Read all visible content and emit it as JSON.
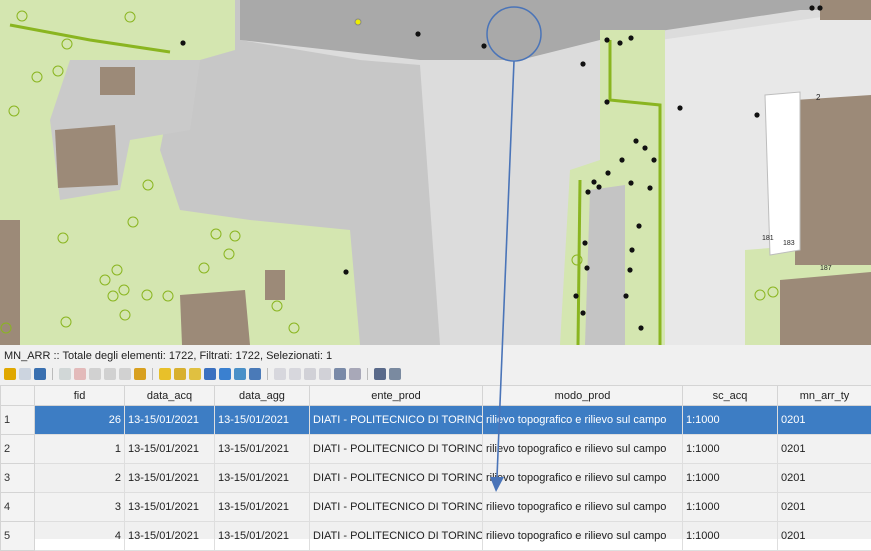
{
  "attribute_table": {
    "status": "MN_ARR :: Totale degli elementi: 1722, Filtrati: 1722, Selezionati: 1",
    "columns": [
      "fid",
      "data_acq",
      "data_agg",
      "ente_prod",
      "modo_prod",
      "sc_acq",
      "mn_arr_ty"
    ],
    "rows": [
      {
        "row": "1",
        "fid": "26",
        "data_acq": "13-15/01/2021",
        "data_agg": "13-15/01/2021",
        "ente_prod": "DIATI - POLITECNICO DI TORINO",
        "modo_prod": "rilievo topografico e rilievo sul campo",
        "sc_acq": "1:1000",
        "mn_arr_ty": "0201",
        "selected": true
      },
      {
        "row": "2",
        "fid": "1",
        "data_acq": "13-15/01/2021",
        "data_agg": "13-15/01/2021",
        "ente_prod": "DIATI - POLITECNICO DI TORINO",
        "modo_prod": "rilievo topografico e rilievo sul campo",
        "sc_acq": "1:1000",
        "mn_arr_ty": "0201",
        "selected": false
      },
      {
        "row": "3",
        "fid": "2",
        "data_acq": "13-15/01/2021",
        "data_agg": "13-15/01/2021",
        "ente_prod": "DIATI - POLITECNICO DI TORINO",
        "modo_prod": "rilievo topografico e rilievo sul campo",
        "sc_acq": "1:1000",
        "mn_arr_ty": "0201",
        "selected": false
      },
      {
        "row": "4",
        "fid": "3",
        "data_acq": "13-15/01/2021",
        "data_agg": "13-15/01/2021",
        "ente_prod": "DIATI - POLITECNICO DI TORINO",
        "modo_prod": "rilievo topografico e rilievo sul campo",
        "sc_acq": "1:1000",
        "mn_arr_ty": "0201",
        "selected": false
      },
      {
        "row": "5",
        "fid": "4",
        "data_acq": "13-15/01/2021",
        "data_agg": "13-15/01/2021",
        "ente_prod": "DIATI - POLITECNICO DI TORINO",
        "modo_prod": "rilievo topografico e rilievo sul campo",
        "sc_acq": "1:1000",
        "mn_arr_ty": "0201",
        "selected": false
      }
    ]
  },
  "toolbar_icons": [
    "pencil-icon",
    "save-icon",
    "reload-icon",
    "add-feature-icon",
    "delete-icon",
    "cut-icon",
    "copy-icon",
    "paste-icon",
    "expression-icon",
    "select-all-icon",
    "invert-selection-icon",
    "deselect-icon",
    "filter-icon",
    "move-selection-top-icon",
    "pan-to-selection-icon",
    "zoom-to-selection-icon",
    "copy-cells-icon",
    "paste-cells-icon",
    "new-field-icon",
    "delete-field-icon",
    "field-calculator-icon",
    "conditional-format-icon",
    "dock-icon",
    "actions-icon"
  ],
  "map_labels": [
    "2",
    "181",
    "183",
    "187"
  ],
  "colors": {
    "selection": "#3d7dc4",
    "arrow": "#4a74b8",
    "green_area": "#cfe3a8",
    "green_line": "#8ab520",
    "building": "#9c8a78",
    "road": "#c4c4c4",
    "paved": "#a8a8a8"
  }
}
